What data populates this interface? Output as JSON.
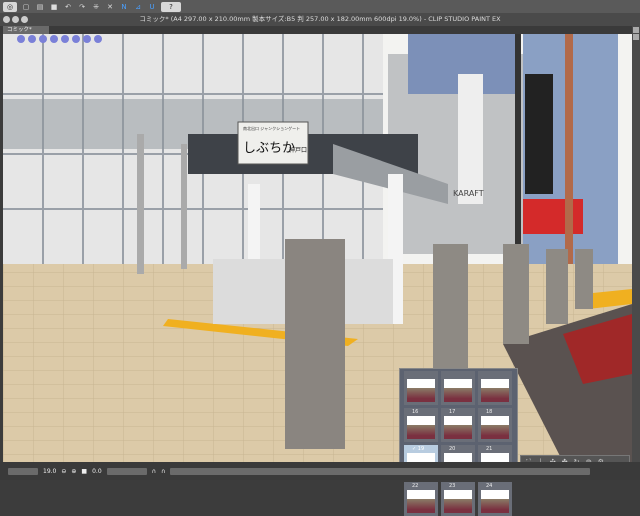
{
  "window_title": "コミック* (A4 297.00 x 210.00mm 製本サイズ:B5 判 257.00 x 182.00mm 600dpi 19.0%) - CLIP STUDIO PAINT EX",
  "tab_label": "コミック*",
  "sign": {
    "main": "しぶちか",
    "sub": "神戸口",
    "small": "南北出口  ジャンクションゲート"
  },
  "store_sign": "KARAFT",
  "status": {
    "zoom": "19.0",
    "angle": "0.0"
  },
  "thumbnails": [
    "16",
    "17",
    "18",
    "19",
    "20",
    "21",
    "22",
    "23",
    "24"
  ],
  "selected_thumbnail": "19",
  "colors": {
    "accent": "#4aa0ff",
    "ground": "#d9c6a8",
    "road": "#8a2a2a"
  }
}
